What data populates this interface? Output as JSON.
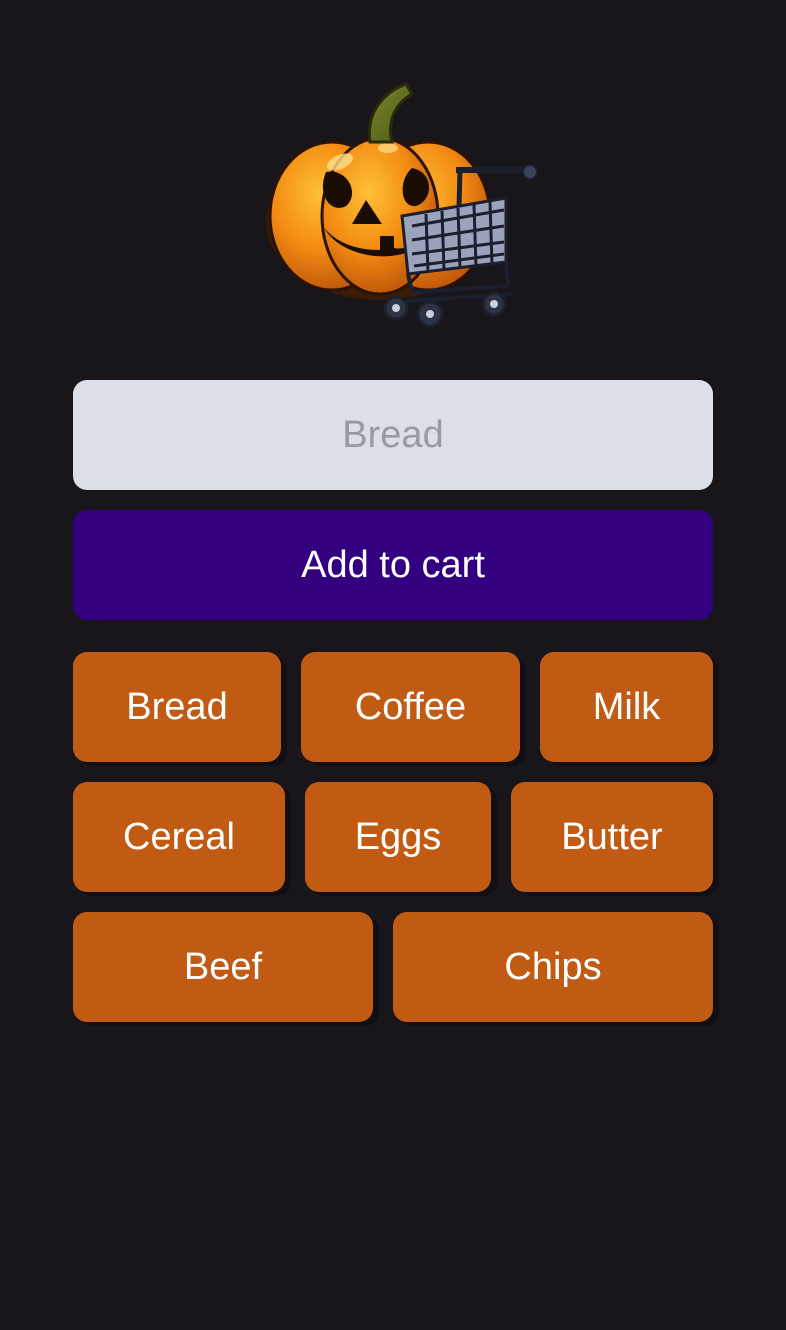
{
  "app": {
    "logo_icon": "jack-o-lantern-with-shopping-cart",
    "background_color": "#18151b"
  },
  "input": {
    "placeholder": "Bread",
    "value": ""
  },
  "add_button": {
    "label": "Add to cart",
    "color": "#33007f"
  },
  "quick_items": {
    "color": "#c15b13",
    "rows": [
      [
        "Bread",
        "Coffee",
        "Milk"
      ],
      [
        "Cereal",
        "Eggs",
        "Butter"
      ],
      [
        "Beef",
        "Chips"
      ]
    ]
  }
}
